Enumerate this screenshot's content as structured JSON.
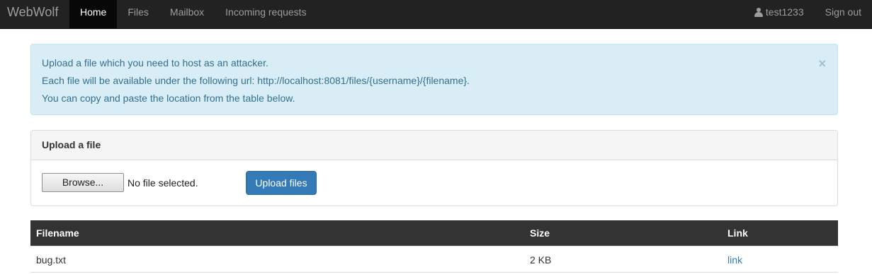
{
  "navbar": {
    "brand": "WebWolf",
    "items": [
      {
        "label": "Home",
        "active": true
      },
      {
        "label": "Files",
        "active": false
      },
      {
        "label": "Mailbox",
        "active": false
      },
      {
        "label": "Incoming requests",
        "active": false
      }
    ],
    "user": "test1233",
    "signout": "Sign out"
  },
  "alert": {
    "line1": "Upload a file which you need to host as an attacker.",
    "line2": "Each file will be available under the following url: http://localhost:8081/files/{username}/{filename}.",
    "line3": "You can copy and paste the location from the table below.",
    "close": "×"
  },
  "upload_panel": {
    "title": "Upload a file",
    "browse_label": "Browse...",
    "file_status": "No file selected.",
    "upload_label": "Upload files"
  },
  "files_table": {
    "columns": [
      "Filename",
      "Size",
      "Link"
    ],
    "rows": [
      {
        "filename": "bug.txt",
        "size": "2 KB",
        "link": "link"
      }
    ]
  },
  "colors": {
    "navbar_bg": "#222222",
    "alert_bg": "#d9edf7",
    "alert_text": "#31708f",
    "primary": "#337ab7",
    "table_header_bg": "#333333"
  }
}
